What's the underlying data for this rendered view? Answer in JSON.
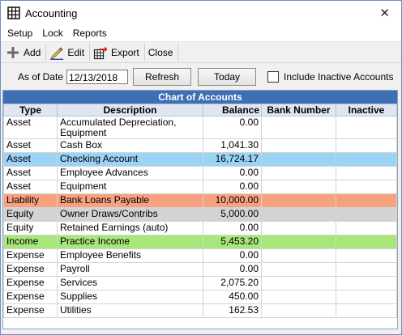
{
  "window": {
    "title": "Accounting",
    "close": "✕"
  },
  "menu": [
    "Setup",
    "Lock",
    "Reports"
  ],
  "toolbar": {
    "add": "Add",
    "edit": "Edit",
    "export": "Export",
    "close": "Close"
  },
  "filter": {
    "as_of_label": "As of Date",
    "date_value": "12/13/2018",
    "refresh": "Refresh",
    "today": "Today",
    "inactive_label": "Include Inactive Accounts",
    "inactive_checked": false
  },
  "grid": {
    "title": "Chart of Accounts",
    "columns": [
      "Type",
      "Description",
      "Balance",
      "Bank Number",
      "Inactive"
    ],
    "rows": [
      {
        "type": "Asset",
        "description": "Accumulated Depreciation, Equipment",
        "balance": "0.00",
        "bank": "",
        "inactive": "",
        "style": ""
      },
      {
        "type": "Asset",
        "description": "Cash Box",
        "balance": "1,041.30",
        "bank": "",
        "inactive": "",
        "style": ""
      },
      {
        "type": "Asset",
        "description": "Checking Account",
        "balance": "16,724.17",
        "bank": "",
        "inactive": "",
        "style": "sel"
      },
      {
        "type": "Asset",
        "description": "Employee Advances",
        "balance": "0.00",
        "bank": "",
        "inactive": "",
        "style": ""
      },
      {
        "type": "Asset",
        "description": "Equipment",
        "balance": "0.00",
        "bank": "",
        "inactive": "",
        "style": ""
      },
      {
        "type": "Liability",
        "description": "Bank Loans Payable",
        "balance": "10,000.00",
        "bank": "",
        "inactive": "",
        "style": "liab"
      },
      {
        "type": "Equity",
        "description": "Owner Draws/Contribs",
        "balance": "5,000.00",
        "bank": "",
        "inactive": "",
        "style": "eq"
      },
      {
        "type": "Equity",
        "description": "Retained Earnings (auto)",
        "balance": "0.00",
        "bank": "",
        "inactive": "",
        "style": ""
      },
      {
        "type": "Income",
        "description": "Practice Income",
        "balance": "5,453.20",
        "bank": "",
        "inactive": "",
        "style": "inc"
      },
      {
        "type": "Expense",
        "description": "Employee Benefits",
        "balance": "0.00",
        "bank": "",
        "inactive": "",
        "style": ""
      },
      {
        "type": "Expense",
        "description": "Payroll",
        "balance": "0.00",
        "bank": "",
        "inactive": "",
        "style": ""
      },
      {
        "type": "Expense",
        "description": "Services",
        "balance": "2,075.20",
        "bank": "",
        "inactive": "",
        "style": ""
      },
      {
        "type": "Expense",
        "description": "Supplies",
        "balance": "450.00",
        "bank": "",
        "inactive": "",
        "style": ""
      },
      {
        "type": "Expense",
        "description": "Utilities",
        "balance": "162.53",
        "bank": "",
        "inactive": "",
        "style": ""
      }
    ]
  },
  "colors": {
    "selected": "#9bd3f5",
    "liability": "#f7a27e",
    "equity": "#d3d3d3",
    "income": "#a7e77a",
    "header": "#3e6fb4"
  },
  "icons": {
    "app": "grid-icon",
    "add": "plus-icon",
    "edit": "pencil-icon",
    "export": "export-icon"
  }
}
